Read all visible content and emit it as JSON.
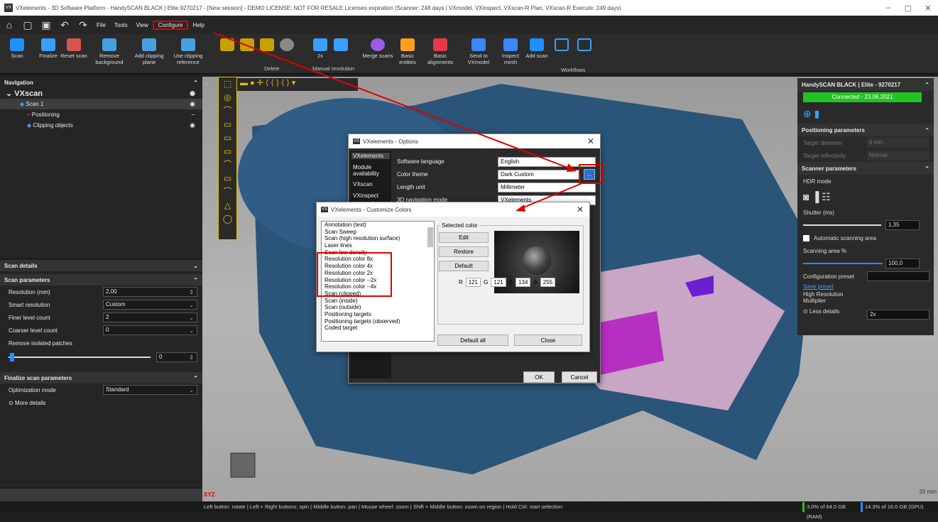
{
  "window": {
    "title": "VXelements - 3D Software Platform - HandySCAN BLACK | Elite 9270217 - [New session] - DEMO LICENSE: NOT FOR RESALE Licenses expiration (Scanner: 248 days | VXmodel, VXinspect, VXscan-R Plan, VXscan-R Execute: 249 days)",
    "logo": "VX"
  },
  "menu": {
    "items": [
      "File",
      "Tools",
      "View",
      "Configure",
      "Help"
    ]
  },
  "ribbon": {
    "buttons": [
      "Scan",
      "Finalize",
      "Reset scan",
      "Remove background",
      "Add clipping plane",
      "Use clipping reference",
      "Merge scans",
      "Basic entities",
      "Basic alignments",
      "Send to VXmodel",
      "Inspect mesh",
      "Add scan"
    ],
    "groups": [
      "Delete",
      "Manual resolution",
      "Workflows"
    ],
    "resolution_label": "2x"
  },
  "navigation": {
    "title": "Navigation",
    "root": "VXscan",
    "items": [
      "Scan 1",
      "Positioning",
      "Clipping objects"
    ]
  },
  "scan_details": {
    "title": "Scan details",
    "params_title": "Scan parameters",
    "rows": [
      {
        "label": "Resolution (mm)",
        "value": "2,00"
      },
      {
        "label": "Smart resolution",
        "value": "Custom"
      },
      {
        "label": "Finer level count",
        "value": "2"
      },
      {
        "label": "Coarser level count",
        "value": "0"
      }
    ],
    "remove_label": "Remove isolated patches",
    "remove_value": "0",
    "finalize_title": "Finalize scan parameters",
    "opt_label": "Optimization mode",
    "opt_value": "Standard",
    "more": "More details"
  },
  "right_panel": {
    "device": "HandySCAN BLACK | Elite - 9270217",
    "connected": "Connected - 23.06.2021",
    "pos_title": "Positioning parameters",
    "target_diameter": "Target diameter",
    "target_diameter_val": "6 mm",
    "target_refl": "Target reflectivity",
    "target_refl_val": "Normal",
    "scanner_title": "Scanner parameters",
    "hdr": "HDR mode",
    "shutter": "Shutter (ms)",
    "shutter_val": "1,35",
    "auto_area": "Automatic scanning area",
    "area_label": "Scanning area %",
    "area_val": "100,0",
    "config": "Configuration preset",
    "save": "Save preset",
    "hires": "High Resolution Multiplier",
    "hires_val": "2x",
    "less": "Less details"
  },
  "options_dialog": {
    "title": "VXelements - Options",
    "nav": [
      "VXelements",
      "Module availability",
      "VXscan",
      "VXinspect"
    ],
    "rows": [
      {
        "label": "Software language",
        "value": "English"
      },
      {
        "label": "Color theme",
        "value": "Dark Custom"
      },
      {
        "label": "Length unit",
        "value": "Millimeter"
      },
      {
        "label": "3D navigation mode",
        "value": "VXelements"
      }
    ],
    "browse": "...",
    "ok": "OK",
    "cancel": "Cancel"
  },
  "colors_dialog": {
    "title": "VXelements - Customize Colors",
    "list": [
      "Annotation (text)",
      "Scan Sweep",
      "Scan (high resolution surface)",
      "Laser lines",
      "Scan low density",
      "Resolution color 8x",
      "Resolution color 4x",
      "Resolution color 2x",
      "Resolution color --2x",
      "Resolution color --4x",
      "Scan (clipped)",
      "Scan (inside)",
      "Scan (outside)",
      "Positioning targets",
      "Positioning targets (observed)",
      "Coded target"
    ],
    "selected_label": "Selected color",
    "edit": "Edit",
    "restore": "Restore",
    "default": "Default",
    "r": "121",
    "g": "121",
    "b": "134",
    "a": "255",
    "default_all": "Default all",
    "close": "Close"
  },
  "viewport": {
    "axes": "XYZ",
    "scale": "20 mm"
  },
  "status": {
    "hint": "Left button: rotate | Left + Right buttons: spin | Middle button: pan | Mouse wheel: zoom | Shift + Middle button: zoom on region | Hold Ctrl: start selection",
    "ram": "3.0% of 64.0 GB (RAM)",
    "gpu": "14.3% of 16.0 GB (GPU)"
  },
  "colors": {
    "accent": "#1e90ff",
    "red": "#e00000",
    "connected": "#22c322"
  }
}
